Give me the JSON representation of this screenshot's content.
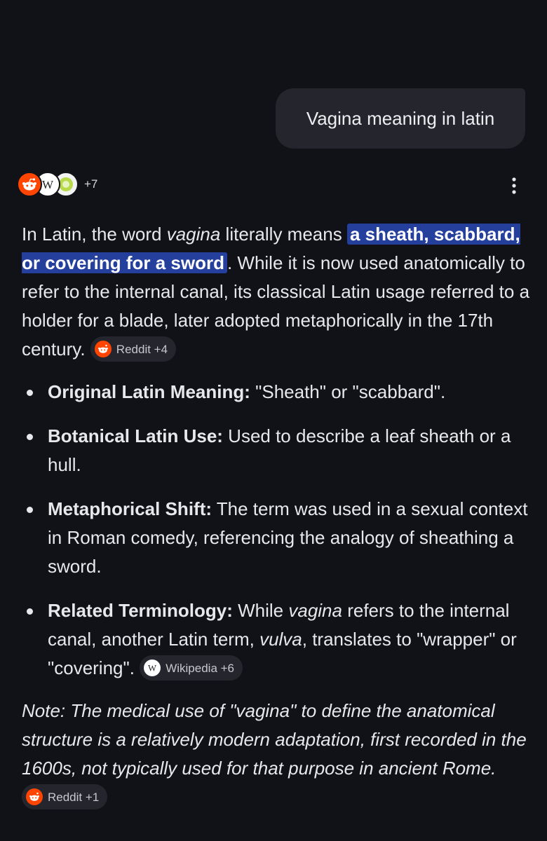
{
  "query": "Vagina meaning in latin",
  "sources": {
    "count_label": "+7",
    "icons": [
      "reddit-icon",
      "wikipedia-icon",
      "site-icon"
    ]
  },
  "answer": {
    "intro": {
      "before": "In Latin, the word ",
      "italic": "vagina",
      "middle": " literally means ",
      "highlight": "a sheath, scabbard, or covering for a sword",
      "after": ". While it is now used anatomically to refer to the internal canal, its classical Latin usage referred to a holder for a blade, later adopted metaphorically in the 17th century.",
      "chip": "Reddit +4"
    },
    "bullets": [
      {
        "label": "Original Latin Meaning:",
        "text": " \"Sheath\" or \"scabbard\"."
      },
      {
        "label": "Botanical Latin Use:",
        "text": " Used to describe a leaf sheath or a hull."
      },
      {
        "label": "Metaphorical Shift:",
        "text": " The term was used in a sexual context in Roman comedy, referencing the analogy of sheathing a sword."
      },
      {
        "label": "Related Terminology:",
        "t1": " While ",
        "i1": "vagina",
        "t2": " refers to the internal canal, another Latin term, ",
        "i2": "vulva",
        "t3": ", translates to \"wrapper\" or \"covering\".",
        "chip": "Wikipedia +6"
      }
    ],
    "note": {
      "text": "Note: The medical use of \"vagina\" to define the anatomical structure is a relatively modern adaptation, first recorded in the 1600s, not typically used for that purpose in ancient Rome.",
      "chip": "Reddit +1"
    }
  },
  "colors": {
    "background": "#111218",
    "bubble": "#25262d",
    "highlight": "#24409c",
    "reddit": "#ff4500"
  }
}
